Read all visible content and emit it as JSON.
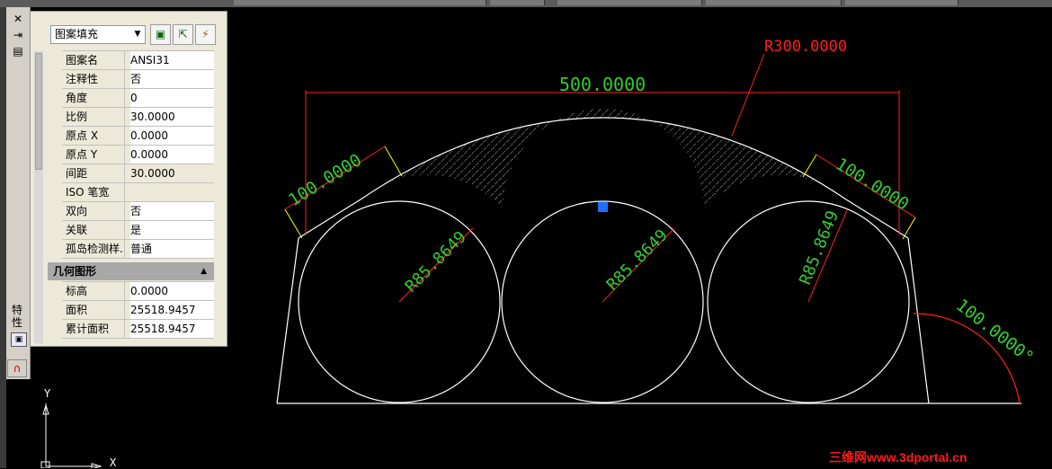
{
  "window": {
    "palette_strip_title": "特性",
    "close_glyph": "✕",
    "autohide_glyph": "⇥",
    "menu_glyph": "▤"
  },
  "properties": {
    "object_type": "图案填充",
    "rows": [
      {
        "key": "图案名",
        "value": "ANSI31"
      },
      {
        "key": "注释性",
        "value": "否"
      },
      {
        "key": "角度",
        "value": "0"
      },
      {
        "key": "比例",
        "value": "30.0000"
      },
      {
        "key": "原点 X",
        "value": "0.0000"
      },
      {
        "key": "原点 Y",
        "value": "0.0000"
      },
      {
        "key": "间距",
        "value": "30.0000"
      },
      {
        "key": "ISO 笔宽",
        "value": ""
      },
      {
        "key": "双向",
        "value": "否"
      },
      {
        "key": "关联",
        "value": "是"
      },
      {
        "key": "孤岛检测样...",
        "value": "普通"
      }
    ],
    "geometry_section": "几何图形",
    "geometry_rows": [
      {
        "key": "标高",
        "value": "0.0000"
      },
      {
        "key": "面积",
        "value": "25518.9457"
      },
      {
        "key": "累计面积",
        "value": "25518.9457"
      }
    ]
  },
  "drawing": {
    "dim_width": "500.0000",
    "dim_radius_arc": "R300.0000",
    "dim_left_edge": "100.0000",
    "dim_right_edge": "100.0000",
    "dim_circle_radius": "R85.8649",
    "dim_angle": "100.0000°",
    "ucs_y": "Y",
    "ucs_x": "X",
    "colors": {
      "green": "#33cc33",
      "red": "#ff2020",
      "white": "#ffffff",
      "grip": "#1e6eff"
    }
  },
  "watermark": "三维网www.3dportal.cn"
}
